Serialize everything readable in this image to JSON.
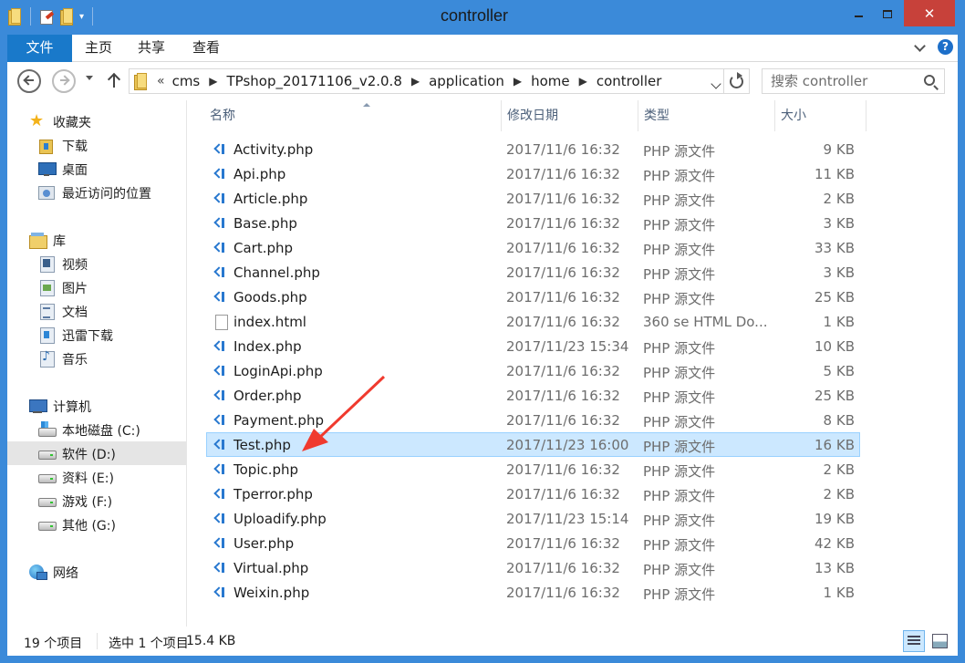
{
  "window": {
    "title": "controller",
    "close_glyph": "✕"
  },
  "ribbon": {
    "tabs": [
      {
        "label": "文件"
      },
      {
        "label": "主页"
      },
      {
        "label": "共享"
      },
      {
        "label": "查看"
      }
    ],
    "help_glyph": "?"
  },
  "address": {
    "lead": "«",
    "sep": "▶",
    "crumbs": [
      "cms",
      "TPshop_20171106_v2.0.8",
      "application",
      "home",
      "controller"
    ]
  },
  "search": {
    "placeholder": "搜索 controller"
  },
  "nav": {
    "favorites": {
      "label": "收藏夹",
      "items": [
        "下载",
        "桌面",
        "最近访问的位置"
      ]
    },
    "libraries": {
      "label": "库",
      "items": [
        "视频",
        "图片",
        "文档",
        "迅雷下载",
        "音乐"
      ]
    },
    "computer": {
      "label": "计算机",
      "items": [
        "本地磁盘 (C:)",
        "软件 (D:)",
        "资料 (E:)",
        "游戏 (F:)",
        "其他 (G:)"
      ]
    },
    "network": {
      "label": "网络"
    },
    "selected": "软件 (D:)"
  },
  "columns": {
    "name": "名称",
    "date": "修改日期",
    "type": "类型",
    "size": "大小"
  },
  "files": [
    {
      "name": "Activity.php",
      "date": "2017/11/6 16:32",
      "type": "PHP 源文件",
      "size": "9 KB",
      "icon": "vscode-icon"
    },
    {
      "name": "Api.php",
      "date": "2017/11/6 16:32",
      "type": "PHP 源文件",
      "size": "11 KB",
      "icon": "vscode-icon"
    },
    {
      "name": "Article.php",
      "date": "2017/11/6 16:32",
      "type": "PHP 源文件",
      "size": "2 KB",
      "icon": "vscode-icon"
    },
    {
      "name": "Base.php",
      "date": "2017/11/6 16:32",
      "type": "PHP 源文件",
      "size": "3 KB",
      "icon": "vscode-icon"
    },
    {
      "name": "Cart.php",
      "date": "2017/11/6 16:32",
      "type": "PHP 源文件",
      "size": "33 KB",
      "icon": "vscode-icon"
    },
    {
      "name": "Channel.php",
      "date": "2017/11/6 16:32",
      "type": "PHP 源文件",
      "size": "3 KB",
      "icon": "vscode-icon"
    },
    {
      "name": "Goods.php",
      "date": "2017/11/6 16:32",
      "type": "PHP 源文件",
      "size": "25 KB",
      "icon": "vscode-icon"
    },
    {
      "name": "index.html",
      "date": "2017/11/6 16:32",
      "type": "360 se HTML Do...",
      "size": "1 KB",
      "icon": "html-file-icon"
    },
    {
      "name": "Index.php",
      "date": "2017/11/23 15:34",
      "type": "PHP 源文件",
      "size": "10 KB",
      "icon": "vscode-icon"
    },
    {
      "name": "LoginApi.php",
      "date": "2017/11/6 16:32",
      "type": "PHP 源文件",
      "size": "5 KB",
      "icon": "vscode-icon"
    },
    {
      "name": "Order.php",
      "date": "2017/11/6 16:32",
      "type": "PHP 源文件",
      "size": "25 KB",
      "icon": "vscode-icon"
    },
    {
      "name": "Payment.php",
      "date": "2017/11/6 16:32",
      "type": "PHP 源文件",
      "size": "8 KB",
      "icon": "vscode-icon"
    },
    {
      "name": "Test.php",
      "date": "2017/11/23 16:00",
      "type": "PHP 源文件",
      "size": "16 KB",
      "icon": "vscode-icon",
      "selected": true
    },
    {
      "name": "Topic.php",
      "date": "2017/11/6 16:32",
      "type": "PHP 源文件",
      "size": "2 KB",
      "icon": "vscode-icon"
    },
    {
      "name": "Tperror.php",
      "date": "2017/11/6 16:32",
      "type": "PHP 源文件",
      "size": "2 KB",
      "icon": "vscode-icon"
    },
    {
      "name": "Uploadify.php",
      "date": "2017/11/23 15:14",
      "type": "PHP 源文件",
      "size": "19 KB",
      "icon": "vscode-icon"
    },
    {
      "name": "User.php",
      "date": "2017/11/6 16:32",
      "type": "PHP 源文件",
      "size": "42 KB",
      "icon": "vscode-icon"
    },
    {
      "name": "Virtual.php",
      "date": "2017/11/6 16:32",
      "type": "PHP 源文件",
      "size": "13 KB",
      "icon": "vscode-icon"
    },
    {
      "name": "Weixin.php",
      "date": "2017/11/6 16:32",
      "type": "PHP 源文件",
      "size": "1 KB",
      "icon": "vscode-icon"
    }
  ],
  "status": {
    "count": "19 个项目",
    "selected": "选中 1 个项目",
    "size": "15.4 KB"
  },
  "colors": {
    "title_bar": "#3b8ad9",
    "file_tab": "#1979ca",
    "close_button": "#c7413a",
    "selection": "#cce8ff",
    "annotation_arrow": "#f03a2e"
  }
}
